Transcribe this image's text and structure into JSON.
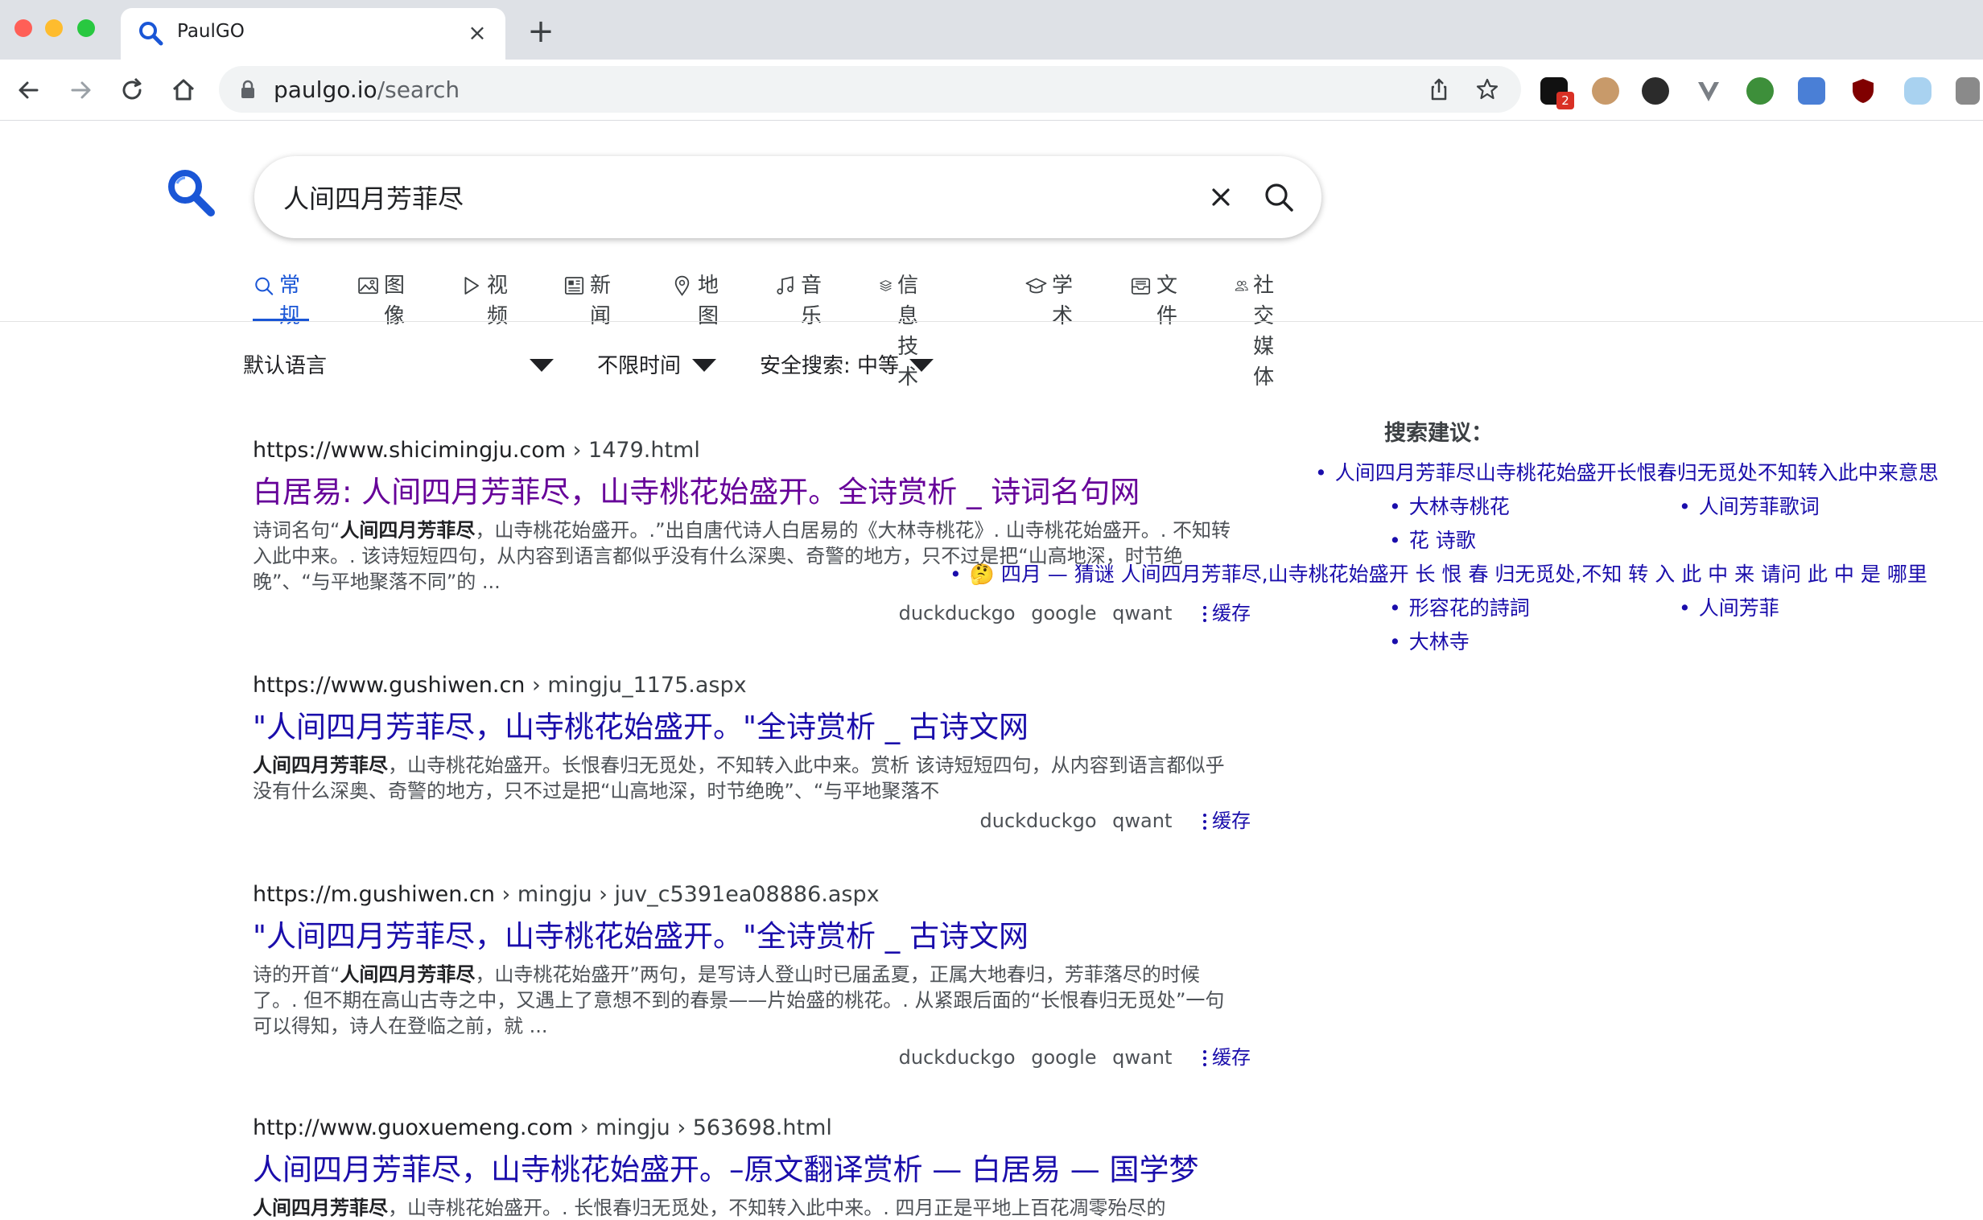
{
  "browser": {
    "tab_title": "PaulGO",
    "url_host": "paulgo.io",
    "url_path": "/search",
    "extension_badge": "2"
  },
  "search": {
    "query": "人间四月芳菲尽"
  },
  "categories": [
    {
      "label": "常规",
      "icon": "search-icon",
      "active": true
    },
    {
      "label": "图像",
      "icon": "image-icon"
    },
    {
      "label": "视频",
      "icon": "play-icon"
    },
    {
      "label": "新闻",
      "icon": "newspaper-icon"
    },
    {
      "label": "地图",
      "icon": "map-pin-icon"
    },
    {
      "label": "音乐",
      "icon": "music-icon"
    },
    {
      "label": "信息技术",
      "icon": "layers-icon"
    },
    {
      "label": "学术",
      "icon": "graduation-cap-icon"
    },
    {
      "label": "文件",
      "icon": "inbox-icon"
    },
    {
      "label": "社交媒体",
      "icon": "people-icon"
    }
  ],
  "filters": {
    "language": "默认语言",
    "time": "不限时间",
    "safesearch": "安全搜索: 中等"
  },
  "results": [
    {
      "url_base": "https://www.shicimingju.com",
      "url_crumbs": "› 1479.html",
      "title": "白居易: 人间四月芳菲尽，山寺桃花始盛开。全诗赏析 _ 诗词名句网",
      "snippet_bold": "人间四月芳菲尽",
      "snippet_pre": "诗词名句“",
      "snippet_post": "，山寺桃花始盛开。.”出自唐代诗人白居易的《大林寺桃花》. 山寺桃花始盛开。. 不知转入此中来。. 该诗短短四句，从内容到语言都似乎没有什么深奥、奇警的地方，只不过是把“山高地深，时节绝晚”、“与平地聚落不同”的 ...",
      "engines": [
        "duckduckgo",
        "google",
        "qwant"
      ],
      "cache": "缓存"
    },
    {
      "url_base": "https://www.gushiwen.cn",
      "url_crumbs": "› mingju_1175.aspx",
      "title": "\"人间四月芳菲尽，山寺桃花始盛开。\"全诗赏析 _ 古诗文网",
      "snippet_bold": "人间四月芳菲尽",
      "snippet_pre": "",
      "snippet_post": "，山寺桃花始盛开。长恨春归无觅处，不知转入此中来。赏析 该诗短短四句，从内容到语言都似乎没有什么深奥、奇警的地方，只不过是把“山高地深，时节绝晚”、“与平地聚落不",
      "engines": [
        "duckduckgo",
        "qwant"
      ],
      "cache": "缓存"
    },
    {
      "url_base": "https://m.gushiwen.cn",
      "url_crumbs": "› mingju › juv_c5391ea08886.aspx",
      "title": "\"人间四月芳菲尽，山寺桃花始盛开。\"全诗赏析 _ 古诗文网",
      "snippet_bold": "人间四月芳菲尽",
      "snippet_pre": "诗的开首“",
      "snippet_post": "，山寺桃花始盛开”两句，是写诗人登山时已届孟夏，正属大地春归，芳菲落尽的时候了。. 但不期在高山古寺之中，又遇上了意想不到的春景——片始盛的桃花。. 从紧跟后面的“长恨春归无觅处”一句可以得知，诗人在登临之前，就 ...",
      "engines": [
        "duckduckgo",
        "google",
        "qwant"
      ],
      "cache": "缓存"
    },
    {
      "url_base": "http://www.guoxuemeng.com",
      "url_crumbs": "› mingju › 563698.html",
      "title": "人间四月芳菲尽，山寺桃花始盛开。–原文翻译赏析 — 白居易 — 国学梦",
      "snippet_bold": "人间四月芳菲尽",
      "snippet_pre": "",
      "snippet_post": "，山寺桃花始盛开。. 长恨春归无觅处，不知转入此中来。. 四月正是平地上百花凋零殆尽的",
      "engines": [],
      "cache": ""
    }
  ],
  "suggestions": {
    "title": "搜索建议：",
    "items": [
      "人间四月芳菲尽山寺桃花始盛开长恨春归无觅处不知转入此中来意思",
      "大林寺桃花",
      "人间芳菲歌词",
      "花 诗歌",
      "🤔 四月 — 猜谜 人间四月芳菲尽,山寺桃花始盛开 长 恨 春 归无觅处,不知 转 入 此 中 来 请问 此 中 是 哪里",
      "形容花的詩詞",
      "人间芳菲",
      "大林寺"
    ]
  }
}
